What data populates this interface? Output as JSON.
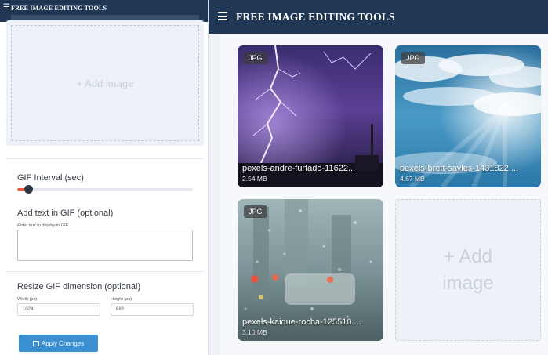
{
  "app": {
    "title": "FREE IMAGE EDITING TOOLS"
  },
  "left_panel": {
    "add_image_label": "+ Add image",
    "gif_interval_label": "GIF Interval (sec)",
    "gif_interval_value": 0.05,
    "text_label": "Add text in GIF (optional)",
    "text_hint": "Enter text to display in GIF",
    "text_value": "",
    "resize_label": "Resize GIF dimension (optional)",
    "width_label": "Width (px)",
    "width_value": "1024",
    "height_label": "Height (px)",
    "height_value": "683",
    "apply_button": "Apply Changes"
  },
  "images": [
    {
      "type": "JPG",
      "name": "pexels-andre-furtado-11622...",
      "size": "2.54 MB",
      "depicts": "lightning storm"
    },
    {
      "type": "JPG",
      "name": "pexels-brett-sayles-1431822....",
      "size": "4.67 MB",
      "depicts": "sky with clouds and sun rays"
    },
    {
      "type": "JPG",
      "name": "pexels-kaique-rocha-125510....",
      "size": "3.10 MB",
      "depicts": "rainy window with traffic"
    }
  ],
  "add_image_tile": {
    "label": "+ Add image"
  },
  "colors": {
    "header": "#1f3654",
    "accent_button": "#3a8fd0",
    "slider_fill": "#e8573c"
  }
}
